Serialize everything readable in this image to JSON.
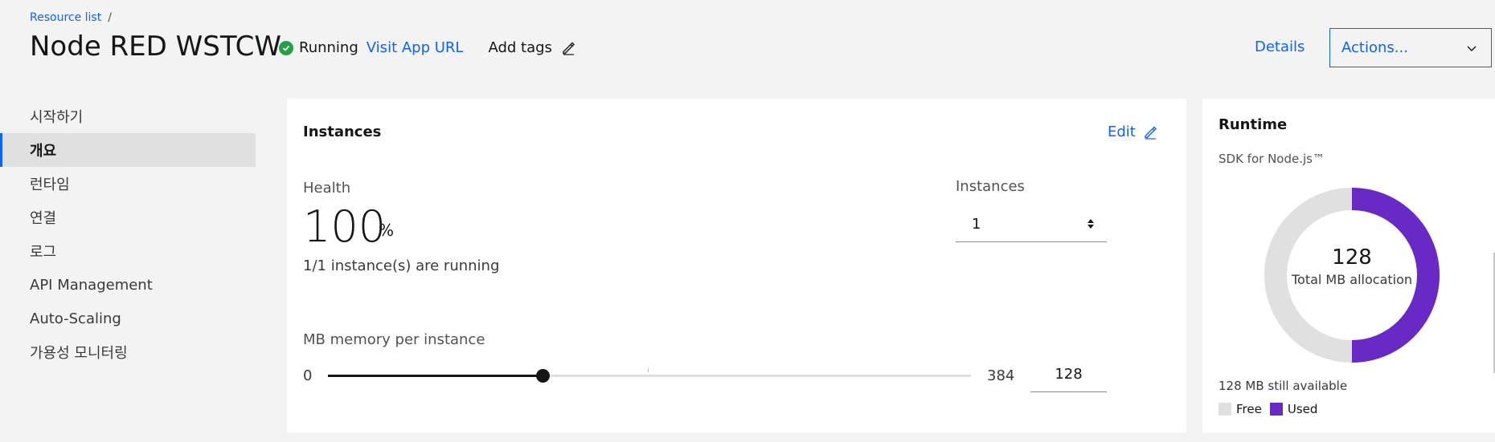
{
  "header": {
    "breadcrumb": "Resource list",
    "breadcrumb_sep": "/",
    "title": "Node RED WSTCW",
    "status": "Running",
    "visit_url": "Visit App URL",
    "add_tags": "Add tags",
    "details": "Details",
    "actions": "Actions..."
  },
  "sidebar": {
    "items": [
      {
        "label": "시작하기"
      },
      {
        "label": "개요",
        "active": true
      },
      {
        "label": "런타임"
      },
      {
        "label": "연결"
      },
      {
        "label": "로그"
      },
      {
        "label": "API Management"
      },
      {
        "label": "Auto-Scaling"
      },
      {
        "label": "가용성 모니터링"
      }
    ]
  },
  "instances_card": {
    "title": "Instances",
    "edit": "Edit",
    "health_label": "Health",
    "health_value": "100",
    "health_unit": "%",
    "health_sub": "1/1 instance(s) are running",
    "instances_label": "Instances",
    "instances_value": "1",
    "memory_label": "MB memory per instance",
    "memory_min": "0",
    "memory_max": "384",
    "memory_value": "128"
  },
  "runtime_card": {
    "title": "Runtime",
    "sdk": "SDK for Node.js™",
    "total": "128",
    "total_label": "Total MB allocation",
    "available": "128 MB still available",
    "legend_free": "Free",
    "legend_used": "Used",
    "used_fraction": 0.5,
    "colors": {
      "free": "#e0e0e0",
      "used": "#6929c4"
    }
  },
  "colors": {
    "accent": "#0f62fe",
    "running": "#24a148"
  }
}
